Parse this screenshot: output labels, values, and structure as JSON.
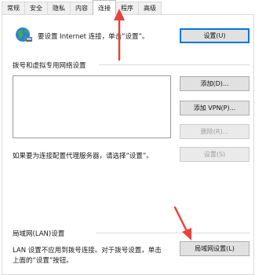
{
  "tabs": [
    "常规",
    "安全",
    "隐私",
    "内容",
    "连接",
    "程序",
    "高级"
  ],
  "active_tab_index": 4,
  "setup": {
    "text": "要设置 Internet 连接，单击“设置”。",
    "button": "设置(U)"
  },
  "dialup_section": {
    "label": "拨号和虚拟专用网络设置",
    "add_button": "添加(D)...",
    "add_vpn_button": "添加 VPN(P)...",
    "remove_button": "删除(R)...",
    "settings_button": "设置(S)",
    "proxy_hint": "如果要为连接配置代理服务器，请选择“设置”。"
  },
  "lan_section": {
    "label": "局域网(LAN)设置",
    "description_line1": "LAN 设置不应用到拨号连接。对于拨号设置，单击",
    "description_line2": "上面的“设置”按钮。",
    "lan_button": "局域网设置(L)"
  },
  "annotation_color": "#e8423a"
}
